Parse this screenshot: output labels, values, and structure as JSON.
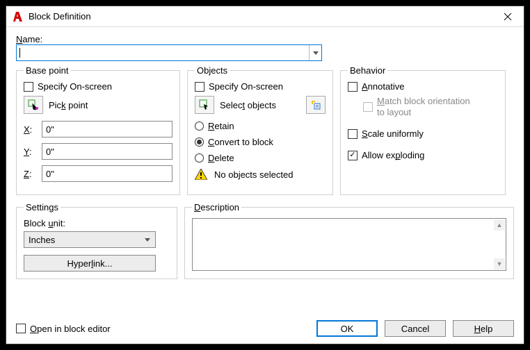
{
  "window": {
    "title": "Block Definition"
  },
  "name": {
    "label": "Name:",
    "label_letter": "N",
    "value": ""
  },
  "basepoint": {
    "legend": "Base point",
    "specify": "Specify On-screen",
    "pick": "Pick point",
    "pick_letter": "k",
    "x_pre": "",
    "x_letter": "X",
    "x_post": ":",
    "y_pre": "",
    "y_letter": "Y",
    "y_post": ":",
    "z_pre": "",
    "z_letter": "Z",
    "z_post": ":",
    "x": "0\"",
    "y": "0\"",
    "z": "0\""
  },
  "objects": {
    "legend": "Objects",
    "specify": "Specify On-screen",
    "select": "Select objects",
    "select_letter": "t",
    "retain_pre": "",
    "retain_letter": "R",
    "retain_post": "etain",
    "convert_pre": "",
    "convert_letter": "C",
    "convert_post": "onvert to block",
    "delete_pre": "",
    "delete_letter": "D",
    "delete_post": "elete",
    "status": "No objects selected"
  },
  "behavior": {
    "legend": "Behavior",
    "annotative_pre": "",
    "annotative_letter": "A",
    "annotative_post": "nnotative",
    "match_pre": "",
    "match_letter": "M",
    "match_post": "atch block orientation",
    "match_sub": "to layout",
    "scale_pre": "",
    "scale_letter": "S",
    "scale_post": "cale uniformly",
    "explode_pre": "Allow ex",
    "explode_letter": "p",
    "explode_post": "loding"
  },
  "settings": {
    "legend": "Settings",
    "blockunit_pre": "Block ",
    "blockunit_letter": "u",
    "blockunit_post": "nit:",
    "unit": "Inches",
    "hyperlink_pre": "Hyper",
    "hyperlink_letter": "l",
    "hyperlink_post": "ink..."
  },
  "description": {
    "legend": "Description",
    "legend_letter": "D",
    "value": ""
  },
  "footer": {
    "open_pre": "",
    "open_letter": "O",
    "open_post": "pen in block editor",
    "ok": "OK",
    "cancel": "Cancel",
    "help_pre": "",
    "help_letter": "H",
    "help_post": "elp"
  }
}
